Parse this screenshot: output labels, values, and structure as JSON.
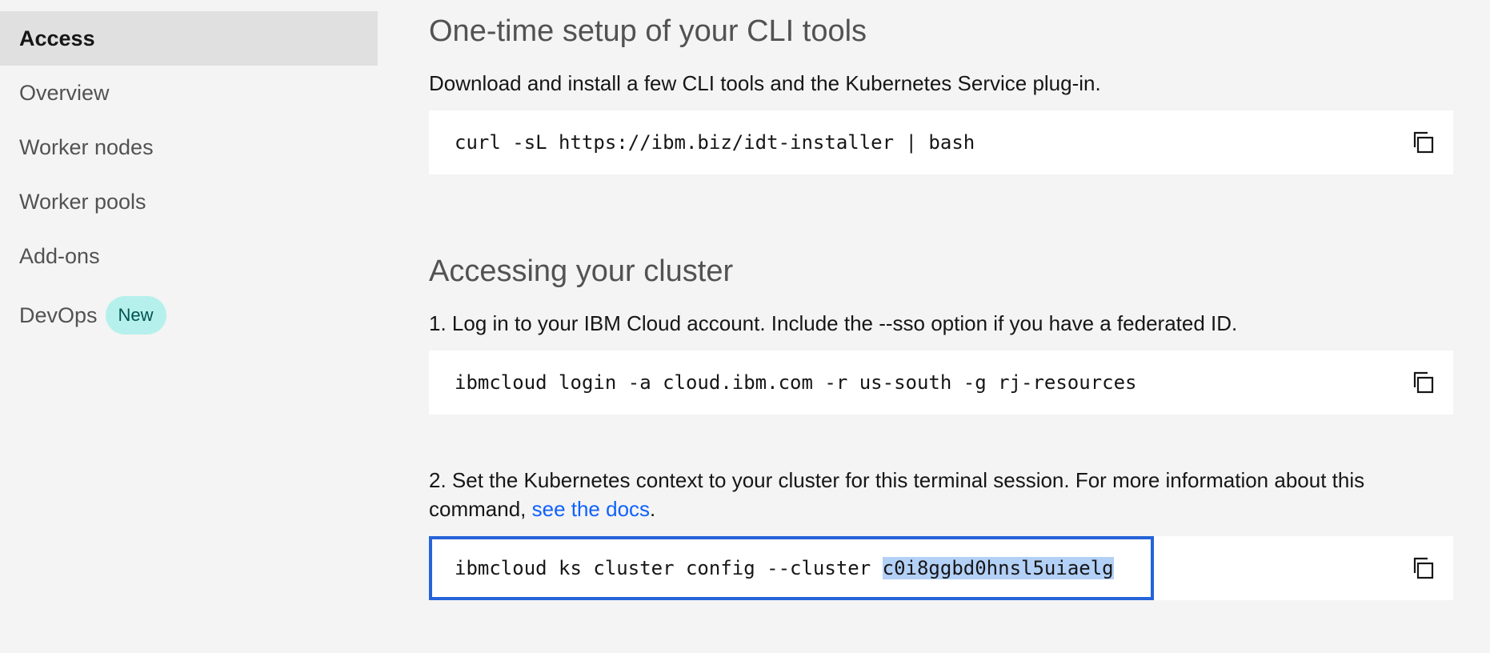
{
  "sidebar": {
    "items": [
      {
        "label": "Access",
        "active": true
      },
      {
        "label": "Overview"
      },
      {
        "label": "Worker nodes"
      },
      {
        "label": "Worker pools"
      },
      {
        "label": "Add-ons"
      },
      {
        "label": "DevOps",
        "badge": "New"
      }
    ]
  },
  "setup": {
    "heading": "One-time setup of your CLI tools",
    "description": "Download and install a few CLI tools and the Kubernetes Service plug-in.",
    "command": "curl -sL https://ibm.biz/idt-installer | bash"
  },
  "access": {
    "heading": "Accessing your cluster",
    "step1": {
      "text": "1. Log in to your IBM Cloud account. Include the --sso option if you have a federated ID.",
      "command": "ibmcloud login -a cloud.ibm.com -r us-south -g rj-resources"
    },
    "step2": {
      "text_before": "2. Set the Kubernetes context to your cluster for this terminal session. For more information about this command, ",
      "link": "see the docs",
      "text_after": ".",
      "command_prefix": "ibmcloud ks cluster config --cluster ",
      "command_selected": "c0i8ggbd0hnsl5uiaelg"
    }
  },
  "icons": {
    "copy": "copy-icon"
  },
  "colors": {
    "link": "#0f62fe",
    "focus": "#2563d8",
    "badge_bg": "#b6f0ec",
    "selection": "#b3d0f7"
  }
}
